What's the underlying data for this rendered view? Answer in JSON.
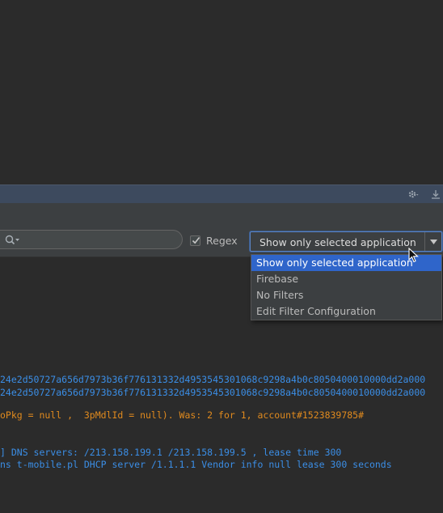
{
  "panel_header": {
    "gear_icon": "gear-icon",
    "hide_icon": "hide-panel-icon"
  },
  "toolbar": {
    "search": {
      "value": "",
      "placeholder": ""
    },
    "regex": {
      "label": "Regex",
      "checked": true
    },
    "filter": {
      "selected": "Show only selected application",
      "options": [
        "Show only selected application",
        "Firebase",
        "No Filters",
        "Edit Filter Configuration"
      ],
      "highlighted_index": 0
    }
  },
  "log": {
    "lines": [
      {
        "text": "24e2d50727a656d7973b36f776131332d4953545301068c9298a4b0c8050400010000dd2a000",
        "color": "#3b8ee6"
      },
      {
        "text": "24e2d50727a656d7973b36f776131332d4953545301068c9298a4b0c8050400010000dd2a000",
        "color": "#3b8ee6"
      },
      {
        "text": "oPkg = null ,  3pMdlId = null). Was: 2 for 1, account#1523839785#",
        "color": "#e08a1e"
      },
      {
        "text": "] DNS servers: /213.158.199.1 /213.158.199.5 , lease time 300",
        "color": "#3b8ee6"
      },
      {
        "text": "ns t-mobile.pl DHCP server /1.1.1.1 Vendor info null lease 300 seconds",
        "color": "#3b8ee6"
      }
    ]
  },
  "colors": {
    "background": "#2b2b2b",
    "toolbar": "#3c3f41",
    "panel_header": "#3d4a5e",
    "selection": "#2f65ca",
    "log_info": "#3b8ee6",
    "log_warn": "#e08a1e"
  }
}
